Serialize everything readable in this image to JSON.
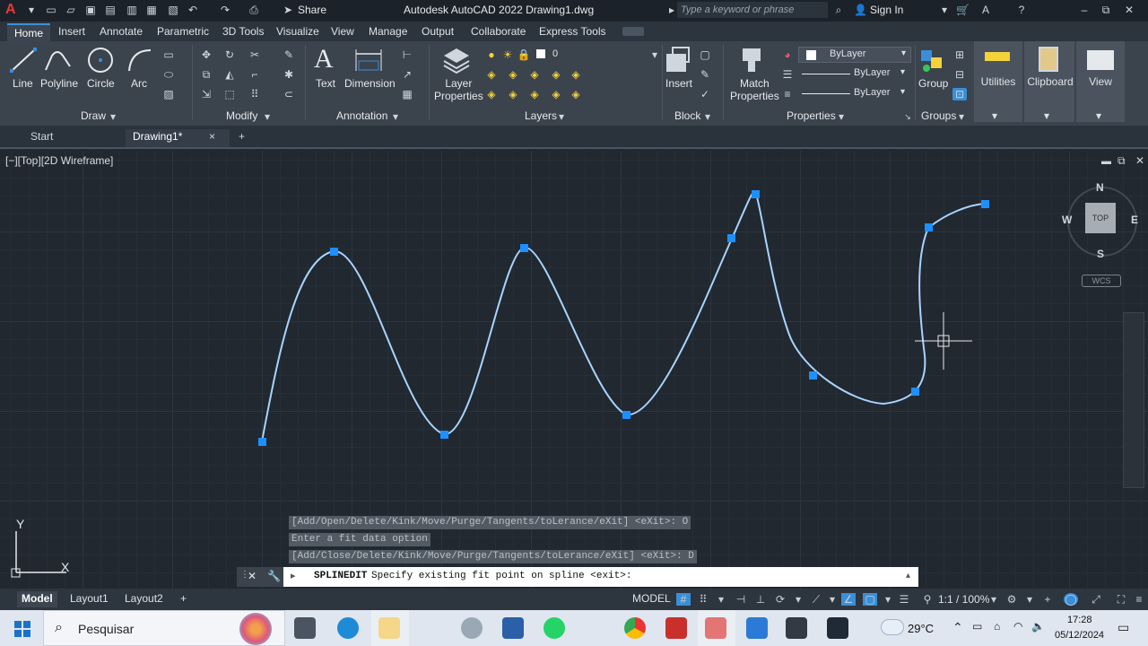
{
  "titlebar": {
    "app_logo": "A",
    "share_label": "Share",
    "title": "Autodesk AutoCAD 2022   Drawing1.dwg",
    "search_placeholder": "Type a keyword or phrase",
    "signin_label": "Sign In"
  },
  "tabs": [
    "Home",
    "Insert",
    "Annotate",
    "Parametric",
    "3D Tools",
    "Visualize",
    "View",
    "Manage",
    "Output",
    "Collaborate",
    "Express Tools"
  ],
  "ribbon": {
    "draw": {
      "title": "Draw",
      "tools": [
        "Line",
        "Polyline",
        "Circle",
        "Arc"
      ]
    },
    "modify": {
      "title": "Modify"
    },
    "annotation": {
      "title": "Annotation",
      "tools": [
        "Text",
        "Dimension"
      ]
    },
    "layers": {
      "title": "Layers",
      "tool_line1": "Layer",
      "tool_line2": "Properties",
      "layer_value": "0"
    },
    "block": {
      "title": "Block",
      "tool": "Insert"
    },
    "properties": {
      "title": "Properties",
      "match_line1": "Match",
      "match_line2": "Properties",
      "color": "ByLayer",
      "linetype": "ByLayer",
      "lineweight": "ByLayer"
    },
    "groups": {
      "title": "Groups",
      "tool": "Group"
    },
    "utilities": "Utilities",
    "clipboard": "Clipboard",
    "view": "View"
  },
  "doctabs": {
    "start": "Start",
    "drawing": "Drawing1*",
    "close": "×",
    "add": "+"
  },
  "viewport": {
    "label": "[−][Top][2D Wireframe]",
    "viewcube": {
      "n": "N",
      "s": "S",
      "e": "E",
      "w": "W",
      "top": "TOP",
      "wcs": "WCS"
    },
    "ucs_x": "X",
    "ucs_y": "Y"
  },
  "command_history": [
    "[Add/Open/Delete/Kink/Move/Purge/Tangents/toLerance/eXit] <eXit>: O",
    "Enter a fit data option",
    "[Add/Close/Delete/Kink/Move/Purge/Tangents/toLerance/eXit] <eXit>: D"
  ],
  "command_line": {
    "command": "SPLINEDIT",
    "prompt": "Specify existing fit point on spline <exit>:"
  },
  "statusbar": {
    "tabs": [
      "Model",
      "Layout1",
      "Layout2"
    ],
    "add": "+",
    "model_label": "MODEL",
    "scale": "1:1 / 100%"
  },
  "taskbar": {
    "search_placeholder": "Pesquisar",
    "temperature": "29°C",
    "time": "17:28",
    "date": "05/12/2024"
  },
  "colors": {
    "spline": "#a8d4ff",
    "fit_point": "#1e8fff",
    "background": "#212830"
  }
}
